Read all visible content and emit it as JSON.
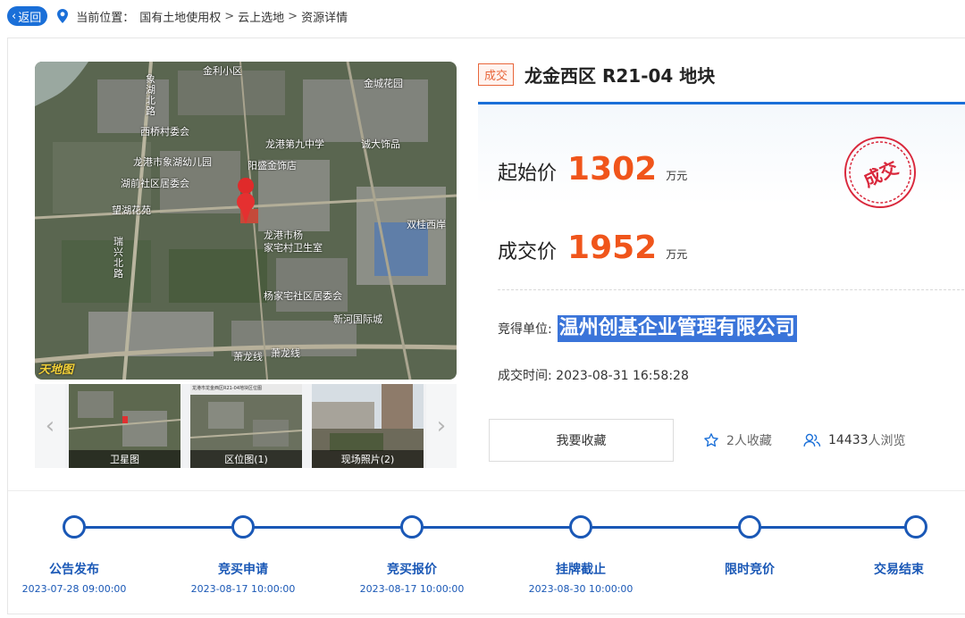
{
  "topbar": {
    "back_label": "返回",
    "location_label": "当前位置：",
    "breadcrumb": [
      "国有土地使用权",
      "云上选地",
      "资源详情"
    ],
    "separator": ">"
  },
  "map": {
    "labels": [
      "金利小区",
      "金城花园",
      "象湖北路",
      "西桥村委会",
      "龙港第九中学",
      "诚大饰品",
      "龙港市象湖幼儿园",
      "阳盛金饰店",
      "湖前社区居委会",
      "望湖花苑",
      "双桂西岸",
      "龙港市杨",
      "家宅村卫生室",
      "瑞兴北路",
      "杨家宅社区居委会",
      "新河国际城",
      "萧龙线",
      "萧龙线"
    ],
    "brand": "天地图"
  },
  "thumbnails": {
    "items": [
      {
        "caption": "卫星图"
      },
      {
        "caption": "区位图(1)"
      },
      {
        "caption": "现场照片(2)"
      }
    ],
    "thumb_header": "龙港市龙金西区R21-04地块区位图"
  },
  "lot": {
    "status_tag": "成交",
    "title": "龙金西区 R21-04 地块",
    "start_price_label": "起始价",
    "start_price": "1302",
    "deal_price_label": "成交价",
    "deal_price": "1952",
    "price_unit": "万元",
    "stamp_text": "成交",
    "winner_label": "竞得单位:",
    "winner_name": "温州创基企业管理有限公司",
    "deal_time_label": "成交时间:",
    "deal_time": "2023-08-31 16:58:28"
  },
  "actions": {
    "favorite_button": "我要收藏",
    "favorites": "2人收藏",
    "views_count": "14433",
    "views_suffix": "人浏览"
  },
  "timeline": [
    {
      "label": "公告发布",
      "date": "2023-07-28 09:00:00"
    },
    {
      "label": "竞买申请",
      "date": "2023-08-17 10:00:00"
    },
    {
      "label": "竞买报价",
      "date": "2023-08-17 10:00:00"
    },
    {
      "label": "挂牌截止",
      "date": "2023-08-30 10:00:00"
    },
    {
      "label": "限时竞价",
      "date": ""
    },
    {
      "label": "交易结束",
      "date": ""
    }
  ],
  "colors": {
    "accent": "#1a6fd8",
    "price": "#f0551b",
    "timeline": "#1a58b6",
    "stamp": "#d9283c"
  }
}
